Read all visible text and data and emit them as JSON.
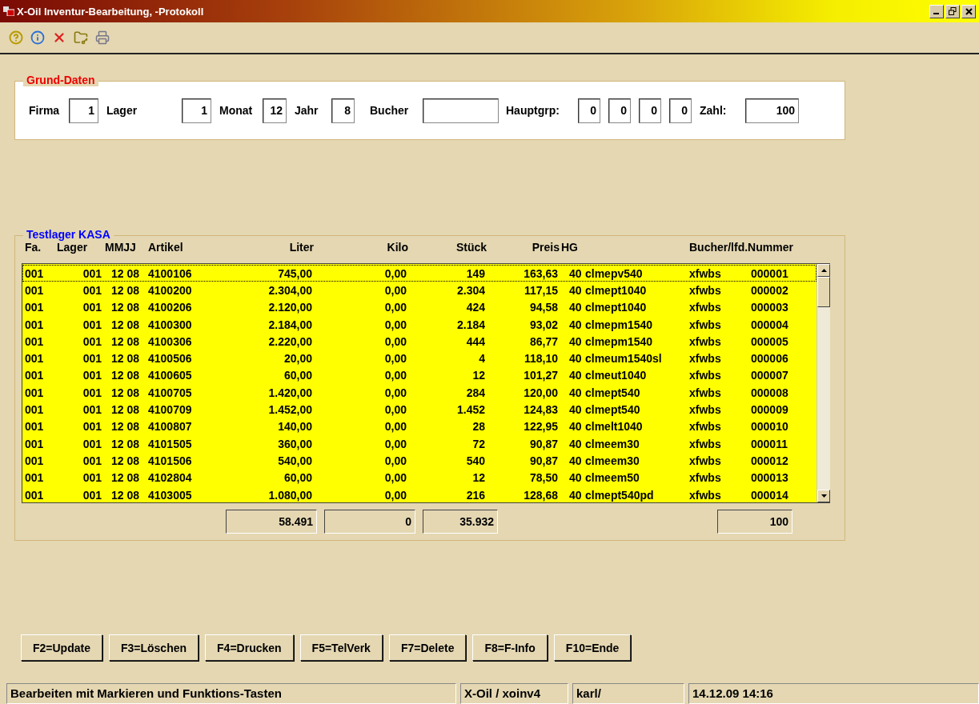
{
  "window": {
    "title": "X-Oil Inventur-Bearbeitung, -Protokoll"
  },
  "toolbar": [
    {
      "kind": "help"
    },
    {
      "kind": "info"
    },
    {
      "kind": "close"
    },
    {
      "kind": "keys"
    },
    {
      "kind": "print"
    }
  ],
  "grund_daten": {
    "title": "Grund-Daten",
    "fields": [
      {
        "label": "Firma",
        "values": [
          "1"
        ]
      },
      {
        "label": "Lager",
        "values": [
          "1"
        ]
      },
      {
        "label": "Monat",
        "values": [
          "12"
        ]
      },
      {
        "label": "Jahr",
        "values": [
          "8"
        ]
      },
      {
        "label": "Bucher"
      },
      {
        "label": "Hauptgrp:",
        "values": [
          "0",
          "0",
          "0",
          "0"
        ]
      },
      {
        "label": "Zahl:",
        "values": [
          "100"
        ]
      }
    ]
  },
  "table": {
    "title": "Testlager KASA",
    "columns": [
      "Fa.",
      "Lager",
      "MMJJ",
      "Artikel",
      "Liter",
      "Kilo",
      "Stück",
      "Preis",
      "HG",
      null,
      "Bucher/lfd.Nummer",
      null
    ],
    "rows": [
      {
        "focused": true,
        "cells": [
          "001",
          "001",
          "12 08",
          "4100106",
          "745,00",
          "0,00",
          "149",
          "163,63",
          "40",
          "clmepv540",
          "xfwbs",
          "000001"
        ]
      },
      {
        "focused": false,
        "cells": [
          "001",
          "001",
          "12 08",
          "4100200",
          "2.304,00",
          "0,00",
          "2.304",
          "117,15",
          "40",
          "clmept1040",
          "xfwbs",
          "000002"
        ]
      },
      {
        "focused": false,
        "cells": [
          "001",
          "001",
          "12 08",
          "4100206",
          "2.120,00",
          "0,00",
          "424",
          "94,58",
          "40",
          "clmept1040",
          "xfwbs",
          "000003"
        ]
      },
      {
        "focused": false,
        "cells": [
          "001",
          "001",
          "12 08",
          "4100300",
          "2.184,00",
          "0,00",
          "2.184",
          "93,02",
          "40",
          "clmepm1540",
          "xfwbs",
          "000004"
        ]
      },
      {
        "focused": false,
        "cells": [
          "001",
          "001",
          "12 08",
          "4100306",
          "2.220,00",
          "0,00",
          "444",
          "86,77",
          "40",
          "clmepm1540",
          "xfwbs",
          "000005"
        ]
      },
      {
        "focused": false,
        "cells": [
          "001",
          "001",
          "12 08",
          "4100506",
          "20,00",
          "0,00",
          "4",
          "118,10",
          "40",
          "clmeum1540sl",
          "xfwbs",
          "000006"
        ]
      },
      {
        "focused": false,
        "cells": [
          "001",
          "001",
          "12 08",
          "4100605",
          "60,00",
          "0,00",
          "12",
          "101,27",
          "40",
          "clmeut1040",
          "xfwbs",
          "000007"
        ]
      },
      {
        "focused": false,
        "cells": [
          "001",
          "001",
          "12 08",
          "4100705",
          "1.420,00",
          "0,00",
          "284",
          "120,00",
          "40",
          "clmept540",
          "xfwbs",
          "000008"
        ]
      },
      {
        "focused": false,
        "cells": [
          "001",
          "001",
          "12 08",
          "4100709",
          "1.452,00",
          "0,00",
          "1.452",
          "124,83",
          "40",
          "clmept540",
          "xfwbs",
          "000009"
        ]
      },
      {
        "focused": false,
        "cells": [
          "001",
          "001",
          "12 08",
          "4100807",
          "140,00",
          "0,00",
          "28",
          "122,95",
          "40",
          "clmelt1040",
          "xfwbs",
          "000010"
        ]
      },
      {
        "focused": false,
        "cells": [
          "001",
          "001",
          "12 08",
          "4101505",
          "360,00",
          "0,00",
          "72",
          "90,87",
          "40",
          "clmeem30",
          "xfwbs",
          "000011"
        ]
      },
      {
        "focused": false,
        "cells": [
          "001",
          "001",
          "12 08",
          "4101506",
          "540,00",
          "0,00",
          "540",
          "90,87",
          "40",
          "clmeem30",
          "xfwbs",
          "000012"
        ]
      },
      {
        "focused": false,
        "cells": [
          "001",
          "001",
          "12 08",
          "4102804",
          "60,00",
          "0,00",
          "12",
          "78,50",
          "40",
          "clmeem50",
          "xfwbs",
          "000013"
        ]
      },
      {
        "focused": false,
        "cells": [
          "001",
          "001",
          "12 08",
          "4103005",
          "1.080,00",
          "0,00",
          "216",
          "128,68",
          "40",
          "clmept540pd",
          "xfwbs",
          "000014"
        ]
      }
    ],
    "totals": {
      "liter": "58.491",
      "kilo": "0",
      "stueck": "35.932",
      "zahl": "100"
    }
  },
  "buttons": [
    "F2=Update",
    "F3=Löschen",
    "F4=Drucken",
    "F5=TelVerk",
    "F7=Delete",
    "F8=F-Info",
    "F10=Ende"
  ],
  "status_bar": [
    "Bearbeiten mit Markieren und Funktions-Tasten",
    "X-Oil / xoinv4",
    "karl/",
    "14.12.09 14:16"
  ]
}
